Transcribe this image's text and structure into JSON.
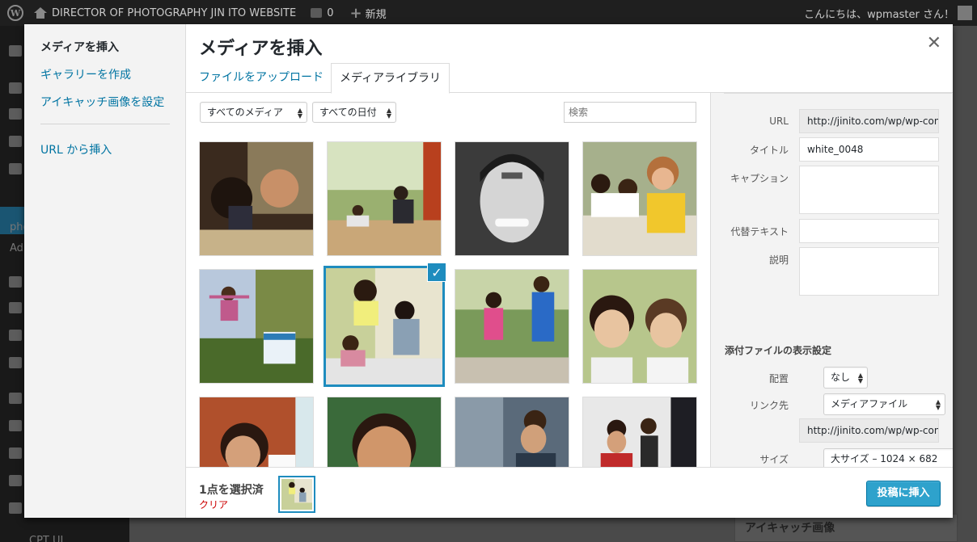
{
  "admin_bar": {
    "wp_logo": "wordpress-icon",
    "site_icon": "home-icon",
    "site_title": "DIRECTOR OF PHOTOGRAPHY JIN ITO WEBSITE",
    "comments_icon": "comment-bubble-icon",
    "comments_count": "0",
    "new_icon": "plus-icon",
    "new_label": "新規",
    "greeting": "こんにちは、wpmaster さん！"
  },
  "background": {
    "menu_text_1": "pho",
    "menu_text_2": "Ad",
    "menu_text_3": "CPT UI",
    "featured_box": "アイキャッチ画像"
  },
  "modal": {
    "title": "メディアを挿入",
    "close_icon": "close-icon",
    "menu": [
      {
        "label": "メディアを挿入",
        "active": true
      },
      {
        "label": "ギャラリーを作成",
        "active": false
      },
      {
        "label": "アイキャッチ画像を設定",
        "active": false
      },
      {
        "label": "URL から挿入",
        "active": false
      }
    ],
    "tabs": [
      {
        "label": "ファイルをアップロード",
        "active": false
      },
      {
        "label": "メディアライブラリ",
        "active": true
      }
    ],
    "filters": {
      "type": "すべてのメディア",
      "date": "すべての日付",
      "search_placeholder": "検索"
    },
    "attachments": [
      {
        "icon": "photo-icon",
        "selected": false
      },
      {
        "icon": "photo-icon",
        "selected": false
      },
      {
        "icon": "photo-icon",
        "selected": false
      },
      {
        "icon": "photo-icon",
        "selected": false
      },
      {
        "icon": "photo-icon",
        "selected": false
      },
      {
        "icon": "photo-icon",
        "selected": true
      },
      {
        "icon": "photo-icon",
        "selected": false
      },
      {
        "icon": "photo-icon",
        "selected": false
      },
      {
        "icon": "photo-icon",
        "selected": false
      },
      {
        "icon": "photo-icon",
        "selected": false
      },
      {
        "icon": "photo-icon",
        "selected": false
      },
      {
        "icon": "photo-icon",
        "selected": false
      }
    ],
    "check_icon": "checkmark-icon",
    "details": {
      "url_label": "URL",
      "url_value": "http://jinito.com/wp/wp-cont",
      "title_label": "タイトル",
      "title_value": "white_0048",
      "caption_label": "キャプション",
      "caption_value": "",
      "alt_label": "代替テキスト",
      "alt_value": "",
      "description_label": "説明",
      "description_value": "",
      "display_settings_header": "添付ファイルの表示設定",
      "align_label": "配置",
      "align_value": "なし",
      "link_label": "リンク先",
      "link_value": "メディアファイル",
      "link_url": "http://jinito.com/wp/wp-cont",
      "size_label": "サイズ",
      "size_value": "大サイズ – 1024 × 682"
    },
    "footer": {
      "selection_count": "1点を選択済",
      "clear_label": "クリア",
      "insert_button": "投稿に挿入"
    }
  }
}
